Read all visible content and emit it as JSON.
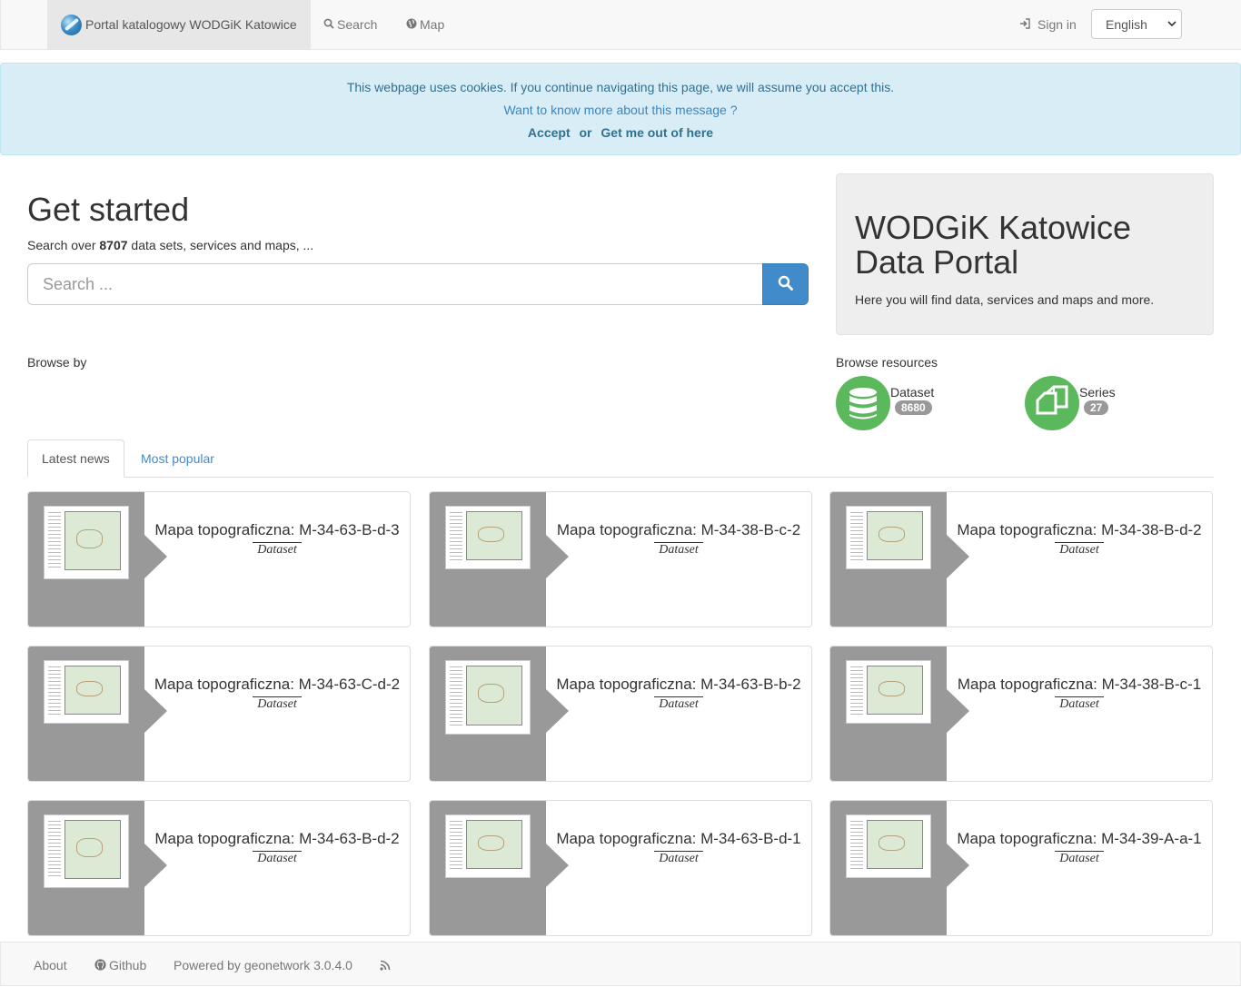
{
  "navbar": {
    "brand": "Portal katalogowy WODGiK Katowice",
    "search": "Search",
    "map": "Map",
    "signin": "Sign in",
    "language": "English"
  },
  "cookie": {
    "message": "This webpage uses cookies. If you continue navigating this page, we will assume you accept this.",
    "more": "Want to know more about this message ?",
    "accept": "Accept",
    "or": "or",
    "leave": "Get me out of here"
  },
  "getstarted": {
    "title": "Get started",
    "prefix": "Search over",
    "count": "8707",
    "suffix": "data sets, services and maps, ...",
    "placeholder": "Search ..."
  },
  "jumbotron": {
    "title": "WODGiK Katowice Data Portal",
    "text": "Here you will find data, services and maps and more."
  },
  "browse": {
    "by": "Browse by",
    "resources": "Browse resources",
    "items": [
      {
        "label": "Dataset",
        "count": "8680",
        "icon": "database-icon"
      },
      {
        "label": "Series",
        "count": "27",
        "icon": "copy-icon"
      }
    ]
  },
  "tabs": {
    "latest": "Latest news",
    "popular": "Most popular"
  },
  "cards": [
    {
      "title": "Mapa topograficzna: M-34-63-B-d-3",
      "type": "Dataset"
    },
    {
      "title": "Mapa topograficzna: M-34-38-B-c-2",
      "type": "Dataset"
    },
    {
      "title": "Mapa topograficzna: M-34-38-B-d-2",
      "type": "Dataset"
    },
    {
      "title": "Mapa topograficzna: M-34-63-C-d-2",
      "type": "Dataset"
    },
    {
      "title": "Mapa topograficzna: M-34-63-B-b-2",
      "type": "Dataset"
    },
    {
      "title": "Mapa topograficzna: M-34-38-B-c-1",
      "type": "Dataset"
    },
    {
      "title": "Mapa topograficzna: M-34-63-B-d-2",
      "type": "Dataset"
    },
    {
      "title": "Mapa topograficzna: M-34-63-B-d-1",
      "type": "Dataset"
    },
    {
      "title": "Mapa topograficzna: M-34-39-A-a-1",
      "type": "Dataset"
    }
  ],
  "footer": {
    "about": "About",
    "github": "Github",
    "powered": "Powered by geonetwork 3.0.4.0"
  },
  "colors": {
    "accent": "#428bca",
    "resource": "#5cb85c",
    "card_side": "#999999"
  }
}
